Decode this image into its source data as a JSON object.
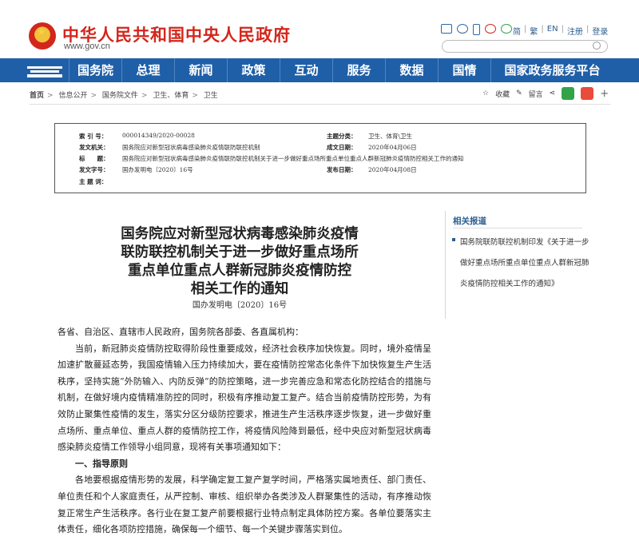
{
  "header": {
    "site_title": "中华人民共和国中央人民政府",
    "site_url": "www.gov.cn",
    "links": [
      "简",
      "繁",
      "EN",
      "注册",
      "登录"
    ]
  },
  "nav": {
    "items": [
      "国务院",
      "总理",
      "新闻",
      "政策",
      "互动",
      "服务",
      "数据",
      "国情",
      "国家政务服务平台"
    ]
  },
  "breadcrumb": [
    "首页",
    "信息公开",
    "国务院文件",
    "卫生、体育",
    "卫生"
  ],
  "tools": {
    "favorite": "收藏",
    "comment": "留言",
    "plus": "+"
  },
  "info": {
    "index_label": "索 引 号：",
    "index_value": "000014349/2020-00028",
    "topic_label": "主题分类：",
    "topic_value": "卫生、体育\\卫生",
    "issuer_label": "发文机关：",
    "issuer_value": "国务院应对新型冠状病毒感染肺炎疫情联防联控机制",
    "created_label": "成文日期：",
    "created_value": "2020年04月06日",
    "title_label": "标　　题：",
    "title_value": "国务院应对新型冠状病毒感染肺炎疫情联防联控机制关于进一步做好重点场所重点单位重点人群新冠肺炎疫情防控相关工作的通知",
    "docno_label": "发文字号：",
    "docno_value": "国办发明电〔2020〕16号",
    "published_label": "发布日期：",
    "published_value": "2020年04月08日",
    "keywords_label": "主 题 词："
  },
  "document": {
    "title_lines": [
      "国务院应对新型冠状病毒感染肺炎疫情",
      "联防联控机制关于进一步做好重点场所",
      "重点单位重点人群新冠肺炎疫情防控",
      "相关工作的通知"
    ],
    "doc_number": "国办发明电〔2020〕16号",
    "salutation": "各省、自治区、直辖市人民政府，国务院各部委、各直属机构：",
    "para1": "当前，新冠肺炎疫情防控取得阶段性重要成效，经济社会秩序加快恢复。同时，境外疫情呈加速扩散蔓延态势，我国疫情输入压力持续加大，要在疫情防控常态化条件下加快恢复生产生活秩序，坚持实施“外防输入、内防反弹”的防控策略，进一步完善应急和常态化防控结合的措施与机制，在做好境内疫情精准防控的同时，积极有序推动复工复产。结合当前疫情防控形势，为有效防止聚集性疫情的发生，落实分区分级防控要求，推进生产生活秩序逐步恢复，进一步做好重点场所、重点单位、重点人群的疫情防控工作，将疫情风险降到最低，经中央应对新型冠状病毒感染肺炎疫情工作领导小组同意，现将有关事项通知如下：",
    "heading1": "一、指导原则",
    "para2": "各地要根据疫情形势的发展，科学确定复工复产复学时间，严格落实属地责任、部门责任、单位责任和个人家庭责任，从严控制、审核、组织举办各类涉及人群聚集性的活动，有序推动恢复正常生产生活秩序。各行业在复工复产前要根据行业特点制定具体防控方案。各单位要落实主体责任，细化各项防控措施，确保每一个细节、每一个关键步骤落实到位。"
  },
  "related": {
    "title": "相关报道",
    "items": [
      "国务院联防联控机制印发《关于进一步做好重点场所重点单位重点人群新冠肺炎疫情防控相关工作的通知》"
    ]
  }
}
